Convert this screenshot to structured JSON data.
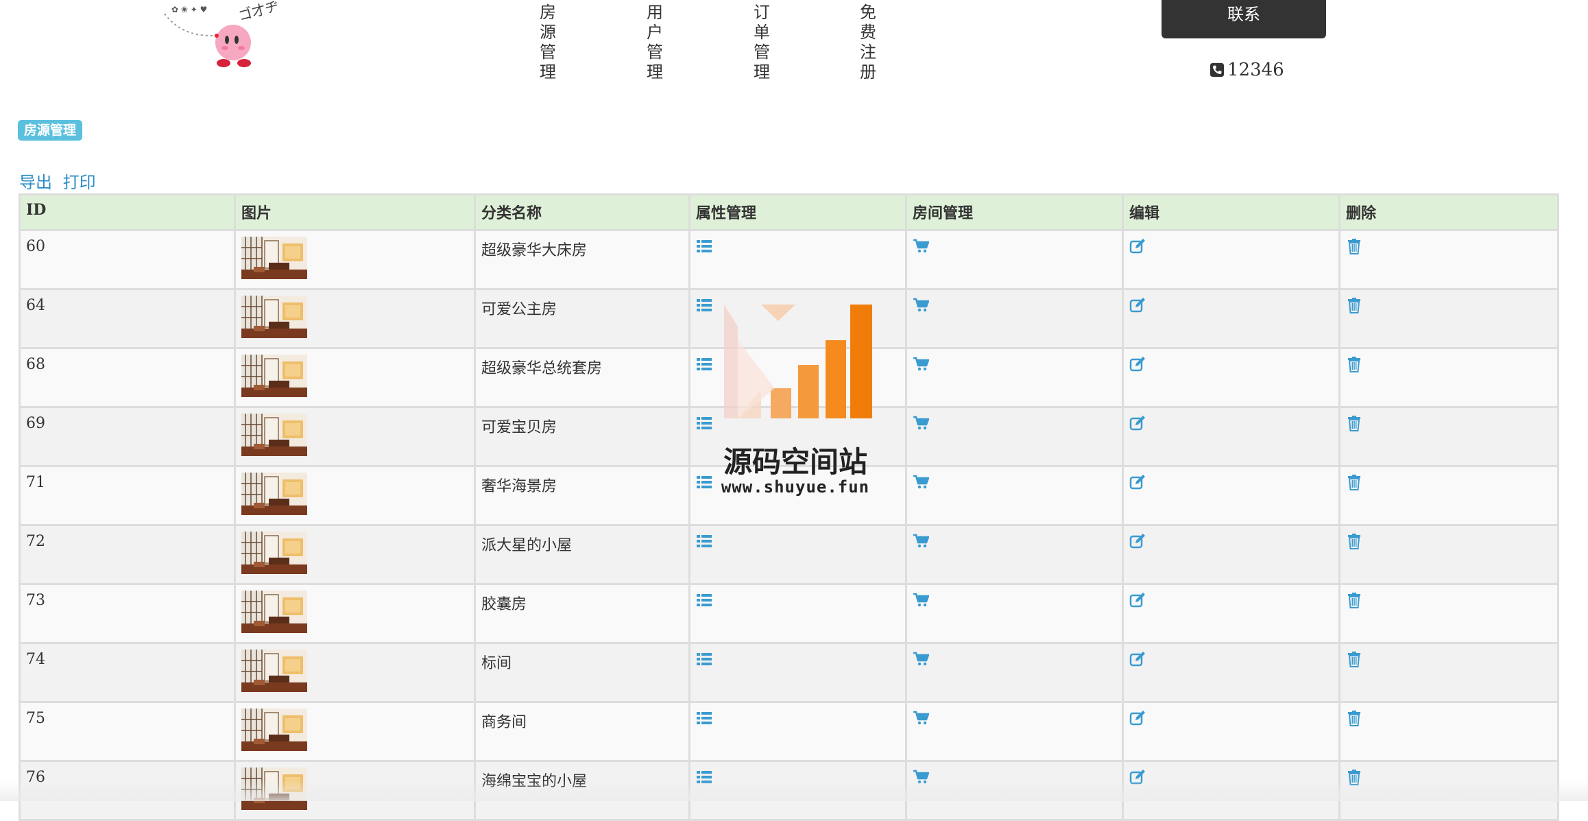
{
  "header": {
    "nav": [
      {
        "label": "房\n源\n管\n理"
      },
      {
        "label": "用\n户\n管\n理"
      },
      {
        "label": "订\n单\n管\n理"
      },
      {
        "label": "免\n费\n注\n册"
      }
    ],
    "contact_label": "联系",
    "phone": "12346"
  },
  "section_badge": "房源管理",
  "actions": {
    "export": "导出",
    "print": "打印"
  },
  "table": {
    "columns": [
      "ID",
      "图片",
      "分类名称",
      "属性管理",
      "房间管理",
      "编辑",
      "删除"
    ],
    "rows": [
      {
        "id": "60",
        "name": "超级豪华大床房"
      },
      {
        "id": "64",
        "name": "可爱公主房"
      },
      {
        "id": "68",
        "name": "超级豪华总统套房"
      },
      {
        "id": "69",
        "name": "可爱宝贝房"
      },
      {
        "id": "71",
        "name": "奢华海景房"
      },
      {
        "id": "72",
        "name": "派大星的小屋"
      },
      {
        "id": "73",
        "name": "胶囊房"
      },
      {
        "id": "74",
        "name": "标间"
      },
      {
        "id": "75",
        "name": "商务间"
      },
      {
        "id": "76",
        "name": "海绵宝宝的小屋"
      }
    ]
  },
  "icons": {
    "attributes": "list-icon",
    "rooms": "cart-icon",
    "edit": "edit-icon",
    "delete": "trash-icon"
  },
  "colors": {
    "accent": "#2a8bc4",
    "icon": "#3a9bd0",
    "header_row": "#dff0d8",
    "badge": "#5bc0de",
    "button": "#333333"
  },
  "watermark": {
    "title": "源码空间站",
    "url": "www.shuyue.fun"
  }
}
